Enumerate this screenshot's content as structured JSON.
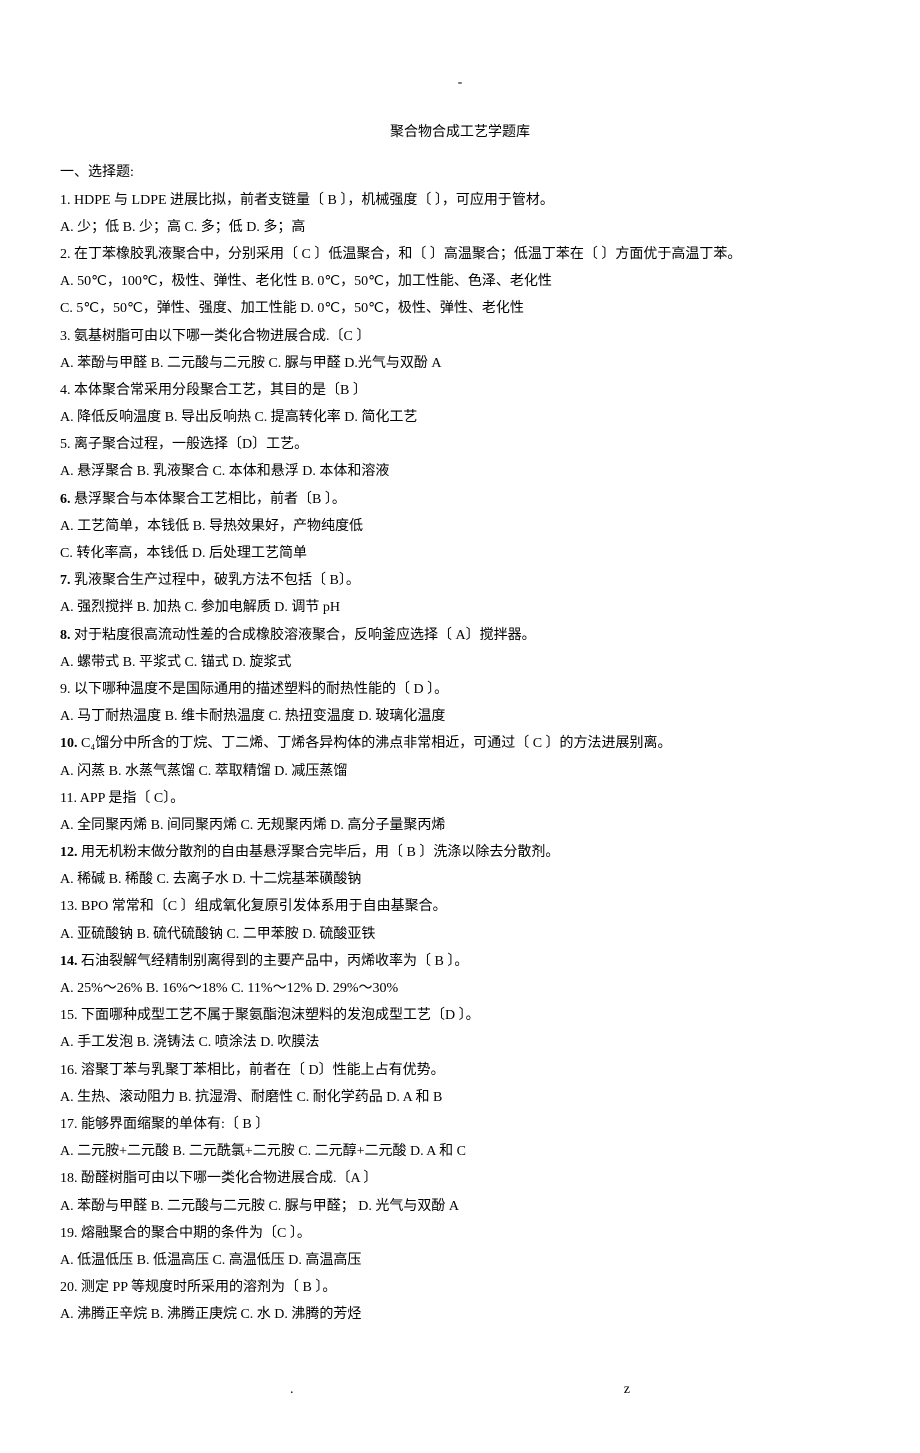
{
  "dashTop": "-",
  "title": "聚合物合成工艺学题库",
  "sectionHeader": "一、选择题:",
  "questions": [
    {
      "num": "1",
      "text": "1. HDPE 与 LDPE 进展比拟，前者支链量〔  B  〕，机械强度〔    〕，可应用于管材。",
      "bold": false,
      "choices": " A. 少；低                 B. 少；高     C. 多；低                   D. 多；高"
    },
    {
      "num": "2",
      "text": "2. 在丁苯橡胶乳液聚合中，分别采用〔  C 〕低温聚合，和〔  〕高温聚合；低温丁苯在〔 〕方面优于高温丁苯。",
      "bold": false,
      "choices": [
        "A. 50℃，100℃，极性、弹性、老化性      B. 0℃，50℃，加工性能、色泽、老化性",
        "C. 5℃，50℃，弹性、强度、加工性能      D. 0℃，50℃，极性、弹性、老化性"
      ]
    },
    {
      "num": "3",
      "text": "3. 氨基树脂可由以下哪一类化合物进展合成.〔C  〕",
      "bold": false,
      "choices": "A. 苯酚与甲醛            B. 二元酸与二元胺      C. 脲与甲醛             D.光气与双酚 A"
    },
    {
      "num": "4",
      "text": "4. 本体聚合常采用分段聚合工艺，其目的是〔B 〕",
      "bold": false,
      "choices": "A. 降低反响温度         B. 导出反响热           C. 提高转化率          D. 简化工艺"
    },
    {
      "num": "5",
      "text": "5. 离子聚合过程，一般选择〔D〕工艺。",
      "bold": false,
      "choices": "A. 悬浮聚合             B. 乳液聚合             C. 本体和悬浮           D. 本体和溶液"
    },
    {
      "num": "6",
      "text": "6. 悬浮聚合与本体聚合工艺相比，前者〔B 〕。",
      "bold": true,
      "choices": [
        "A. 工艺简单，本钱低        B. 导热效果好，产物纯度低",
        "C. 转化率高，本钱低        D. 后处理工艺简单"
      ]
    },
    {
      "num": "7",
      "text": "7. 乳液聚合生产过程中，破乳方法不包括〔 B〕。",
      "bold": true,
      "choices": "A. 强烈搅拌        B. 加热             C. 参加电解质    D. 调节 pH"
    },
    {
      "num": "8",
      "text": "8. 对于粘度很高流动性差的合成橡胶溶液聚合，反响釜应选择〔 A〕搅拌器。",
      "bold": true,
      "choices": "A. 螺带式         B. 平浆式          C. 锚式         D. 旋浆式"
    },
    {
      "num": "9",
      "text": "9. 以下哪种温度不是国际通用的描述塑料的耐热性能的〔 D 〕。",
      "bold": false,
      "choices": "A. 马丁耐热温度           B. 维卡耐热温度     C. 热扭变温度        D. 玻璃化温度"
    },
    {
      "num": "10",
      "text": "10. C₄馏分中所含的丁烷、丁二烯、丁烯各异构体的沸点非常相近，可通过〔  C 〕的方法进展别离。",
      "bold": true,
      "choices": "A. 闪蒸              B. 水蒸气蒸馏       C. 萃取精馏          D. 减压蒸馏"
    },
    {
      "num": "11",
      "text": "11. APP 是指〔 C〕。",
      "bold": false,
      "choices": "A. 全同聚丙烯           B. 间同聚丙烯     C. 无规聚丙烯          D. 高分子量聚丙烯"
    },
    {
      "num": "12",
      "text": "12. 用无机粉末做分散剂的自由基悬浮聚合完毕后，用〔 B 〕洗涤以除去分散剂。",
      "bold": true,
      "choices": "A. 稀碱               B. 稀酸   C. 去离子水            D. 十二烷基苯磺酸钠"
    },
    {
      "num": "13",
      "text": "13. BPO 常常和〔C 〕组成氧化复原引发体系用于自由基聚合。",
      "bold": false,
      "choices": "A. 亚硫酸钠          B. 硫代硫酸钠 C. 二甲苯胺           D. 硫酸亚铁"
    },
    {
      "num": "14",
      "text": "14. 石油裂解气经精制别离得到的主要产品中，丙烯收率为〔 B  〕。",
      "bold": true,
      "choices": "A. 25%～26%        B. 16%～18%    C. 11%～12%             D. 29%～30%"
    },
    {
      "num": "15",
      "text": "15. 下面哪种成型工艺不属于聚氨酯泡沫塑料的发泡成型工艺〔D 〕。",
      "bold": false,
      "choices": "A. 手工发泡             B. 浇铸法           C. 喷涂法                   D. 吹膜法"
    },
    {
      "num": "16",
      "text": "16. 溶聚丁苯与乳聚丁苯相比，前者在〔 D〕性能上占有优势。",
      "bold": false,
      "choices": " A. 生热、滚动阻力       B. 抗湿滑、耐磨性    C. 耐化学药品             D. A 和 B"
    },
    {
      "num": "17",
      "text": "17. 能够界面缩聚的单体有:〔 B  〕",
      "bold": false,
      "choices": " A. 二元胺+二元酸         B. 二元酰氯+二元胺    C. 二元醇+二元酸        D. A 和 C"
    },
    {
      "num": "18",
      "text": "18. 酚醛树脂可由以下哪一类化合物进展合成.〔A 〕",
      "bold": false,
      "choices": " A. 苯酚与甲醛            B. 二元酸与二元胺   C. 脲与甲醛；            D. 光气与双酚 A"
    },
    {
      "num": "19",
      "text": "19. 熔融聚合的聚合中期的条件为〔C 〕。",
      "bold": false,
      "choices": " A. 低温低压             B. 低温高压      C. 高温低压               D. 高温高压"
    },
    {
      "num": "20",
      "text": "20. 测定 PP 等规度时所采用的溶剂为〔 B 〕。",
      "bold": false,
      "choices": " A. 沸腾正辛烷           B. 沸腾正庚烷    C. 水                    D. 沸腾的芳烃"
    }
  ],
  "footerLeft": ".",
  "footerRight": "z"
}
